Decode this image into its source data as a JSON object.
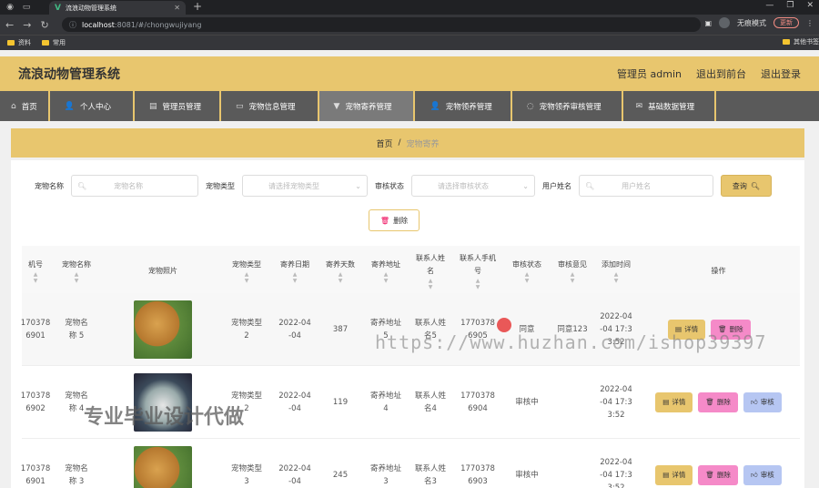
{
  "browser": {
    "tab_title": "流浪动物管理系统",
    "url_host": "localhost",
    "url_path": ":8081/#/chongwujiyang",
    "incognito_label": "无痕模式",
    "update_label": "更新",
    "bookmarks": [
      "资料",
      "常用"
    ],
    "other_bookmarks": "其他书签"
  },
  "header": {
    "title": "流浪动物管理系统",
    "user": "管理员 admin",
    "back_label": "退出到前台",
    "logout_label": "退出登录"
  },
  "nav": {
    "items": [
      {
        "label": "首页",
        "icon": "home-icon"
      },
      {
        "label": "个人中心",
        "icon": "user-icon"
      },
      {
        "label": "管理员管理",
        "icon": "admin-icon"
      },
      {
        "label": "宠物信息管理",
        "icon": "pet-info-icon"
      },
      {
        "label": "宠物寄养管理",
        "icon": "foster-icon"
      },
      {
        "label": "宠物领养管理",
        "icon": "adopt-icon"
      },
      {
        "label": "宠物领养审核管理",
        "icon": "audit-icon"
      },
      {
        "label": "基础数据管理",
        "icon": "data-icon"
      }
    ]
  },
  "breadcrumb": {
    "home": "首页",
    "sep": "/",
    "current": "宠物寄养"
  },
  "search": {
    "pet_name_label": "宠物名称",
    "pet_name_placeholder": "宠物名称",
    "pet_type_label": "宠物类型",
    "pet_type_placeholder": "请选择宠物类型",
    "audit_label": "审核状态",
    "audit_placeholder": "请选择审核状态",
    "user_label": "用户姓名",
    "user_placeholder": "用户姓名",
    "query_label": "查询",
    "delete_label": "删除"
  },
  "table": {
    "headers": {
      "phone": "机号",
      "pet_name": "宠物名称",
      "photo": "宠物照片",
      "type": "宠物类型",
      "date": "寄养日期",
      "days": "寄养天数",
      "addr": "寄养地址",
      "contact": "联系人姓名",
      "contact_phone": "联系人手机号",
      "status": "审核状态",
      "opinion": "审核意见",
      "time": "添加时间",
      "ops": "操作"
    },
    "rows": [
      {
        "phone": "170378 6901",
        "pet_name": "宠物名称 5",
        "type": "宠物类型 2",
        "date": "2022-04 -04",
        "days": "387",
        "addr": "寄养地址 5",
        "contact": "联系人姓 名5",
        "contact_phone": "1770378 6905",
        "status": "同意",
        "opinion": "同意123",
        "time": "2022-04 -04 17:3 3:52"
      },
      {
        "phone": "170378 6902",
        "pet_name": "宠物名称 4",
        "type": "宠物类型 2",
        "date": "2022-04 -04",
        "days": "119",
        "addr": "寄养地址 4",
        "contact": "联系人姓 名4",
        "contact_phone": "1770378 6904",
        "status": "审核中",
        "opinion": "",
        "time": "2022-04 -04 17:3 3:52"
      },
      {
        "phone": "170378 6901",
        "pet_name": "宠物名称 3",
        "type": "宠物类型 3",
        "date": "2022-04 -04",
        "days": "245",
        "addr": "寄养地址 3",
        "contact": "联系人姓 名3",
        "contact_phone": "1770378 6903",
        "status": "审核中",
        "opinion": "",
        "time": "2022-04 -04 17:3 3:52"
      }
    ],
    "op_detail": "详情",
    "op_delete": "删除",
    "op_audit": "审核"
  },
  "watermarks": {
    "url": "https://www.huzhan.com/ishop39397",
    "cn": "专业毕业设计代做"
  }
}
